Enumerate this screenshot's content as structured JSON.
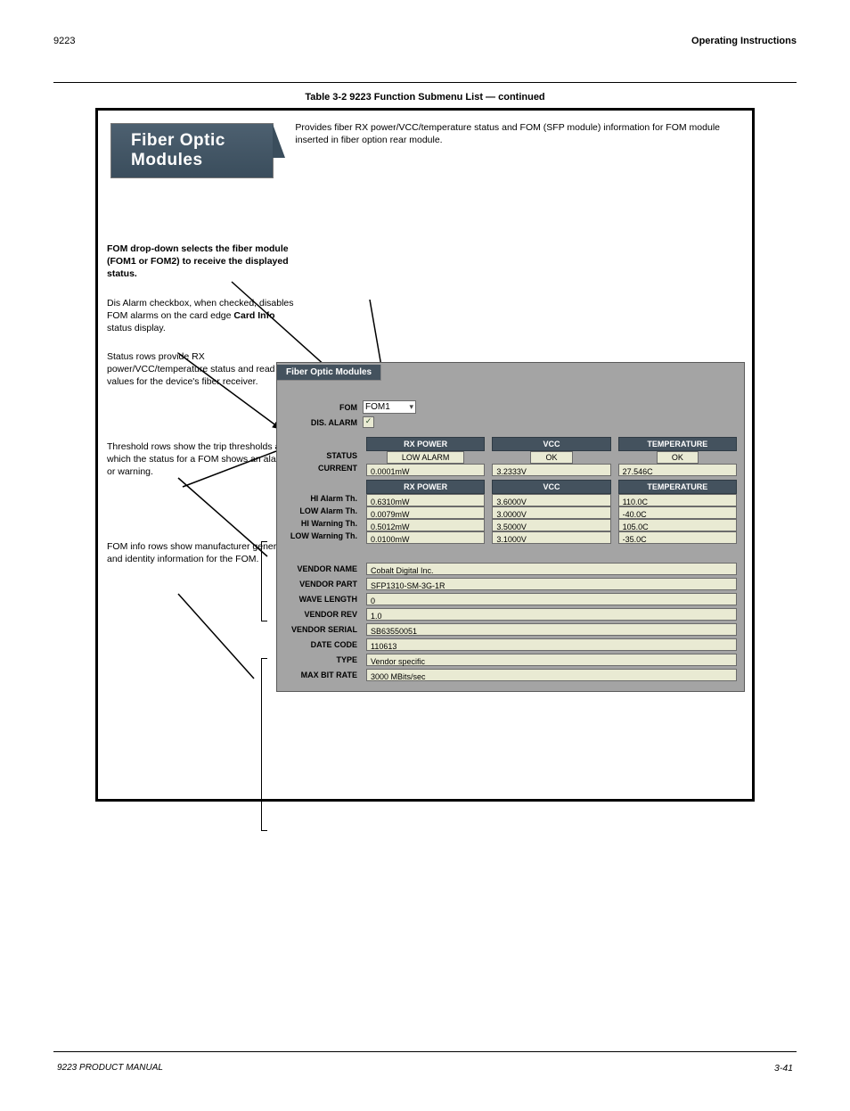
{
  "page": {
    "product": "9223",
    "breadcrumb": "Operating Instructions",
    "footer_left": "9223 PRODUCT MANUAL",
    "page_number": "3-41"
  },
  "section": {
    "table_heading": "Table 3-2  9223 Function Submenu List — continued",
    "title_tab": "Fiber Optic Modules",
    "subtitle": "Provides fiber RX power/VCC/temperature status and FOM (SFP module) information for FOM module inserted in fiber option rear module."
  },
  "callouts": {
    "c1": "FOM drop-down selects the fiber module (FOM1 or FOM2) to receive the displayed status.",
    "c2_a": "Dis Alarm checkbox, when checked, disables FOM alarms on the card edge ",
    "c2_b": "Card Info",
    "c2_c": " status display.",
    "c3": "Status rows provide RX power/VCC/temperature status and read values for the device's fiber receiver.",
    "c4": "Threshold rows show the trip thresholds at which the status for a FOM shows an alarm or warning.",
    "c5": "FOM info rows show manufacturer general and identity information for the FOM."
  },
  "panel": {
    "tab": "Fiber Optic Modules",
    "labels": {
      "fom": "FOM",
      "dis_alarm": "DIS. ALARM",
      "status": "STATUS",
      "current": "CURRENT",
      "hi_alarm": "HI Alarm Th.",
      "low_alarm": "LOW Alarm Th.",
      "hi_warn": "HI Warning Th.",
      "low_warn": "LOW Warning Th.",
      "vendor_name": "VENDOR NAME",
      "vendor_part": "VENDOR PART",
      "wave_length": "WAVE LENGTH",
      "vendor_rev": "VENDOR REV",
      "vendor_serial": "VENDOR SERIAL",
      "date_code": "DATE CODE",
      "type": "TYPE",
      "max_bit_rate": "MAX BIT RATE"
    },
    "fom_select": "FOM1",
    "dis_alarm_checked": true,
    "columns": {
      "rx_power": "RX POWER",
      "vcc": "VCC",
      "temperature": "TEMPERATURE"
    },
    "status": {
      "rx_power": "LOW ALARM",
      "vcc": "OK",
      "temperature": "OK"
    },
    "current": {
      "rx_power": "0.0001mW",
      "vcc": "3.2333V",
      "temperature": "27.546C"
    },
    "hi_alarm": {
      "rx_power": "0.6310mW",
      "vcc": "3.6000V",
      "temperature": "110.0C"
    },
    "low_alarm": {
      "rx_power": "0.0079mW",
      "vcc": "3.0000V",
      "temperature": "-40.0C"
    },
    "hi_warn": {
      "rx_power": "0.5012mW",
      "vcc": "3.5000V",
      "temperature": "105.0C"
    },
    "low_warn": {
      "rx_power": "0.0100mW",
      "vcc": "3.1000V",
      "temperature": "-35.0C"
    },
    "info": {
      "vendor_name": "Cobalt Digital Inc.",
      "vendor_part": "SFP1310-SM-3G-1R",
      "wave_length": "0",
      "vendor_rev": "1.0",
      "vendor_serial": "SB63550051",
      "date_code": "110613",
      "type": "Vendor specific",
      "max_bit_rate": "3000 MBits/sec"
    }
  }
}
